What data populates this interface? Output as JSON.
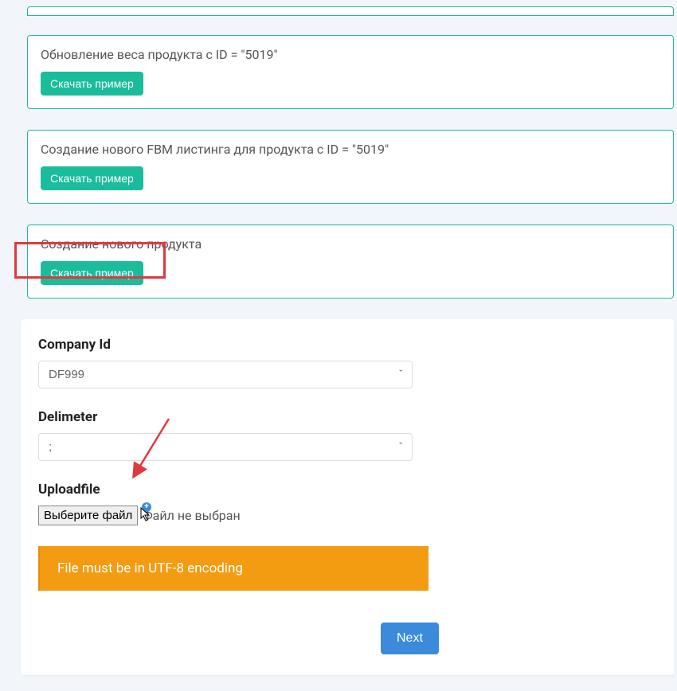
{
  "examples": [
    {
      "title": "Обновление веса продукта с ID = \"5019\"",
      "button": "Скачать пример"
    },
    {
      "title": "Создание нового FBM листинга для продукта с ID = \"5019\"",
      "button": "Скачать пример"
    },
    {
      "title": "Создание нового продукта",
      "button": "Скачать пример"
    }
  ],
  "form": {
    "company_label": "Company Id",
    "company_value": "DF999",
    "delimiter_label": "Delimeter",
    "delimiter_value": ";",
    "upload_label": "Uploadfile",
    "choose_file": "Выберите файл",
    "no_file": "Файл не выбран",
    "warning": "File must be in UTF-8 encoding",
    "next": "Next"
  }
}
